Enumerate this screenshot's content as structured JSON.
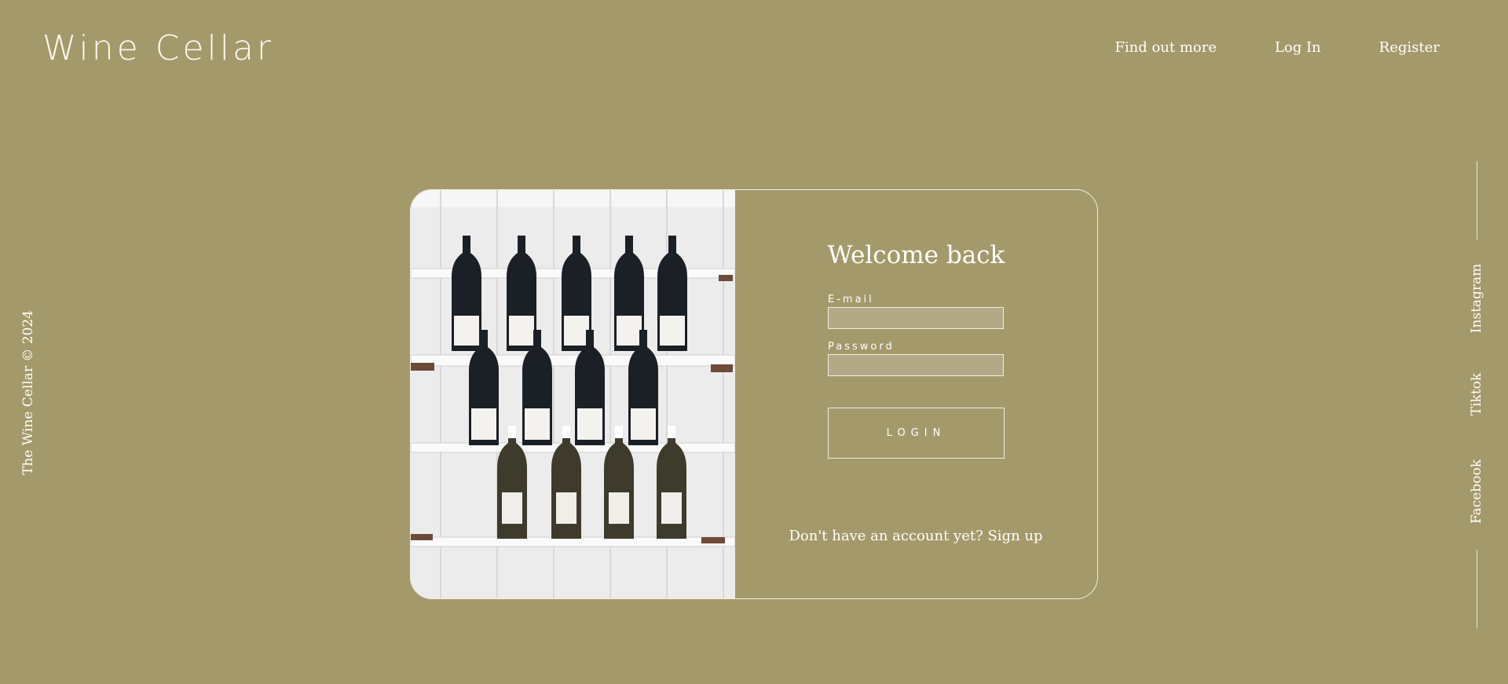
{
  "header": {
    "logo": "Wine Cellar",
    "nav": [
      "Find out more",
      "Log In",
      "Register"
    ]
  },
  "sidebar": {
    "copyright": "The Wine Cellar © 2024",
    "social": [
      "Instagram",
      "Tiktok",
      "Facebook"
    ]
  },
  "card": {
    "title": "Welcome back",
    "email_label": "E-mail",
    "password_label": "Password",
    "email_value": "",
    "password_value": "",
    "login_button": "LOGIN",
    "signup_text": "Don't have an account yet? Sign up"
  },
  "colors": {
    "background": "#a4996a",
    "accent": "#ffffff"
  }
}
